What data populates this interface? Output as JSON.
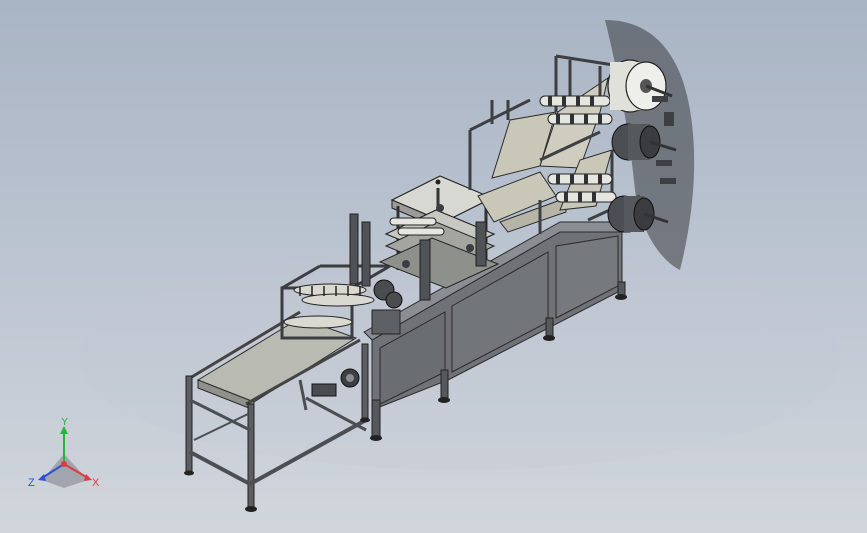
{
  "viewport": {
    "background_top": "#a9b4c4",
    "background_bottom": "#d2d6dc",
    "model_color_metal": "#5f6266",
    "model_color_panel": "#6f7276",
    "model_color_web": "#c9c7b8"
  },
  "triad": {
    "x_label": "X",
    "y_label": "Y",
    "z_label": "Z",
    "x_color": "#e23b3b",
    "y_color": "#25b53a",
    "z_color": "#2f4fd8"
  }
}
